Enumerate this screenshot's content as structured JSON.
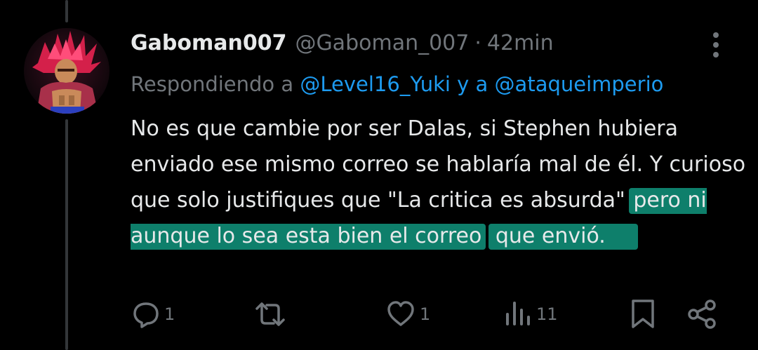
{
  "tweet": {
    "display_name": "Gaboman007",
    "handle": "@Gaboman_007",
    "separator": "·",
    "time": "42min",
    "reply_prefix": "Respondiendo a",
    "reply_mention_1": "@Level16_Yuki",
    "reply_conjunction": "y a",
    "reply_mention_2": "@ataqueimperio",
    "text_plain": "No es que cambie por ser Dalas, si Stephen hubiera enviado ese mismo correo se hablaría mal de él. Y curioso que solo justifiques que \"La critica es absurda\"",
    "text_highlight_1": "pero ni aunque lo sea esta bien el correo",
    "text_highlight_2": "que envió."
  },
  "actions": {
    "replies": "1",
    "retweets": "",
    "likes": "1",
    "views": "11"
  },
  "colors": {
    "background": "#000000",
    "primary_text": "#e7e9ea",
    "secondary_text": "#71767b",
    "mention": "#1d9bf0",
    "highlight": "#0e7f6b"
  },
  "icons": [
    "more-vertical-icon",
    "reply-icon",
    "retweet-icon",
    "like-icon",
    "views-icon",
    "bookmark-icon",
    "share-icon"
  ]
}
